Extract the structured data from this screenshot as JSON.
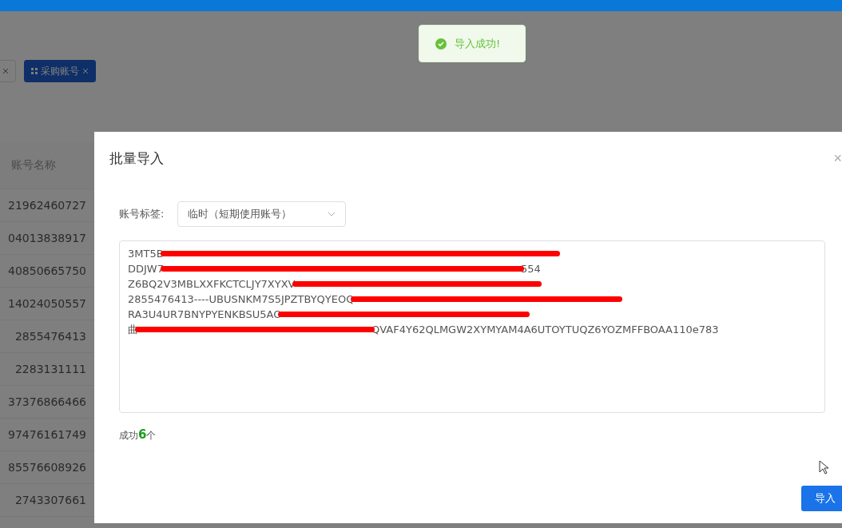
{
  "tabs": [
    {
      "selected": false
    },
    {
      "label": "采购账号",
      "selected": true
    }
  ],
  "table": {
    "columns": [
      "账号名称"
    ],
    "rows": [
      "21962460727",
      "04013838917",
      "40850665750",
      "14024050557",
      "2855476413",
      "2283131111",
      "37376866466",
      "97476161749",
      "85576608926",
      "2743307661"
    ]
  },
  "toast": {
    "kind": "success",
    "text": "导入成功!"
  },
  "dialog": {
    "title": "批量导入",
    "close": "×",
    "field": {
      "label": "账号标签:",
      "value": "临时（短期使用账号）"
    },
    "lines": [
      {
        "before": "3MT5B"
      },
      {
        "before": "DDJW7",
        "after": "554"
      },
      {
        "before": "Z6BQ2V3MBLXXFKCTCLJY7XYXV"
      },
      {
        "before": "2855476413----UBUSNKM7S5JPZTBYQYEOQ"
      },
      {
        "before": "RA3U4UR7BNYPYENKBSU5AO"
      },
      {
        "before": "曲",
        "after": "QVAF4Y62QLMGW2XYMYAM4A6UTOYTUQZ6YOZMFFBOAA110e783"
      }
    ],
    "result": "成功**6**个",
    "button": "导入"
  }
}
